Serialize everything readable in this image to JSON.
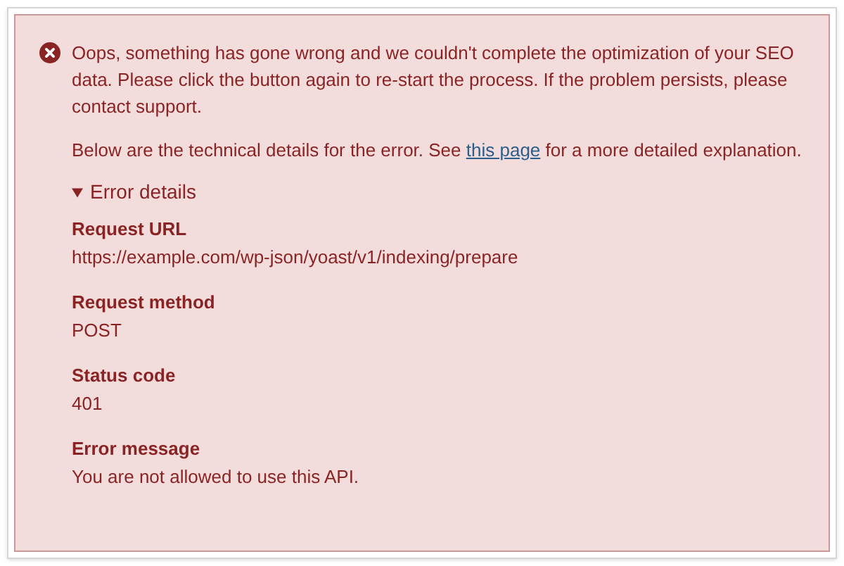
{
  "alert": {
    "message": "Oops, something has gone wrong and we couldn't complete the optimization of your SEO data. Please click the button again to re-start the process. If the problem persists, please contact support.",
    "details_intro": {
      "before": "Below are the technical details for the error. See ",
      "link": "this page",
      "after": " for a more detailed explanation."
    },
    "details": {
      "summary": "Error details",
      "expanded": true,
      "fields": [
        {
          "label": "Request URL",
          "value": "https://example.com/wp-json/yoast/v1/indexing/prepare"
        },
        {
          "label": "Request method",
          "value": "POST"
        },
        {
          "label": "Status code",
          "value": "401"
        },
        {
          "label": "Error message",
          "value": "You are not allowed to use this API."
        }
      ]
    }
  }
}
